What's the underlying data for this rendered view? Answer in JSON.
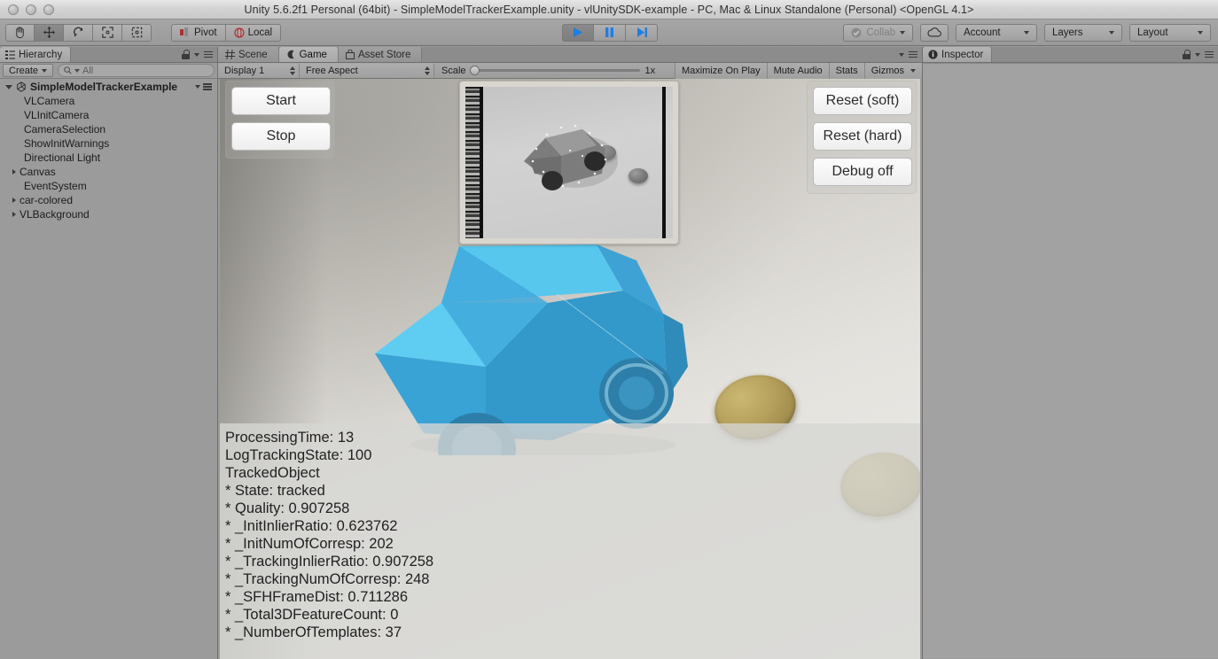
{
  "window": {
    "title": "Unity 5.6.2f1 Personal (64bit) - SimpleModelTrackerExample.unity - vlUnitySDK-example - PC, Mac & Linux Standalone (Personal) <OpenGL 4.1>"
  },
  "toolbar": {
    "tools": [
      {
        "name": "hand-tool",
        "selected": false
      },
      {
        "name": "move-tool",
        "selected": true
      },
      {
        "name": "rotate-tool",
        "selected": false
      },
      {
        "name": "scale-tool",
        "selected": false
      },
      {
        "name": "rect-tool",
        "selected": false
      }
    ],
    "pivot_label": "Pivot",
    "local_label": "Local",
    "play_label": "play-icon",
    "pause_label": "pause-icon",
    "step_label": "step-icon",
    "collab_label": "Collab",
    "cloud_label": "cloud-icon",
    "account_label": "Account",
    "layers_label": "Layers",
    "layout_label": "Layout"
  },
  "hierarchy": {
    "tab_label": "Hierarchy",
    "create_label": "Create",
    "search_placeholder": "All",
    "search_value": "",
    "root": "SimpleModelTrackerExample",
    "items": [
      {
        "label": "VLCamera",
        "expandable": false
      },
      {
        "label": "VLInitCamera",
        "expandable": false
      },
      {
        "label": "CameraSelection",
        "expandable": false
      },
      {
        "label": "ShowInitWarnings",
        "expandable": false
      },
      {
        "label": "Directional Light",
        "expandable": false
      },
      {
        "label": "Canvas",
        "expandable": true
      },
      {
        "label": "EventSystem",
        "expandable": false
      },
      {
        "label": "car-colored",
        "expandable": true
      },
      {
        "label": "VLBackground",
        "expandable": true
      }
    ]
  },
  "gameview": {
    "tabs": [
      {
        "label": "Scene",
        "active": false,
        "icon": "grid-icon"
      },
      {
        "label": "Game",
        "active": true,
        "icon": "gamepad-icon"
      },
      {
        "label": "Asset Store",
        "active": false,
        "icon": "store-icon"
      }
    ],
    "display_label": "Display 1",
    "aspect_label": "Free Aspect",
    "scale_label": "Scale",
    "scale_value": "1x",
    "maximize_label": "Maximize On Play",
    "mute_label": "Mute Audio",
    "stats_label": "Stats",
    "gizmos_label": "Gizmos"
  },
  "overlay_ui": {
    "left_buttons": [
      "Start",
      "Stop"
    ],
    "right_buttons": [
      "Reset (soft)",
      "Reset (hard)",
      "Debug off"
    ]
  },
  "debug_log": {
    "lines": [
      "ProcessingTime: 13",
      "LogTrackingState: 100",
      "TrackedObject",
      "* State: tracked",
      "* Quality: 0.907258",
      "* _InitInlierRatio: 0.623762",
      "* _InitNumOfCorresp: 202",
      "* _TrackingInlierRatio: 0.907258",
      "* _TrackingNumOfCorresp: 248",
      "* _SFHFrameDist: 0.711286",
      "* _Total3DFeatureCount: 0",
      "* _NumberOfTemplates: 37"
    ]
  },
  "inspector": {
    "tab_label": "Inspector"
  },
  "colors": {
    "accent_blue": "#3fa9dc",
    "car_light": "#5fcdf2",
    "car_mid": "#3fa9dc",
    "car_dark": "#2f8bba",
    "panel_gray": "#9b9b9b",
    "toolbar_gray": "#a6a6a6"
  }
}
